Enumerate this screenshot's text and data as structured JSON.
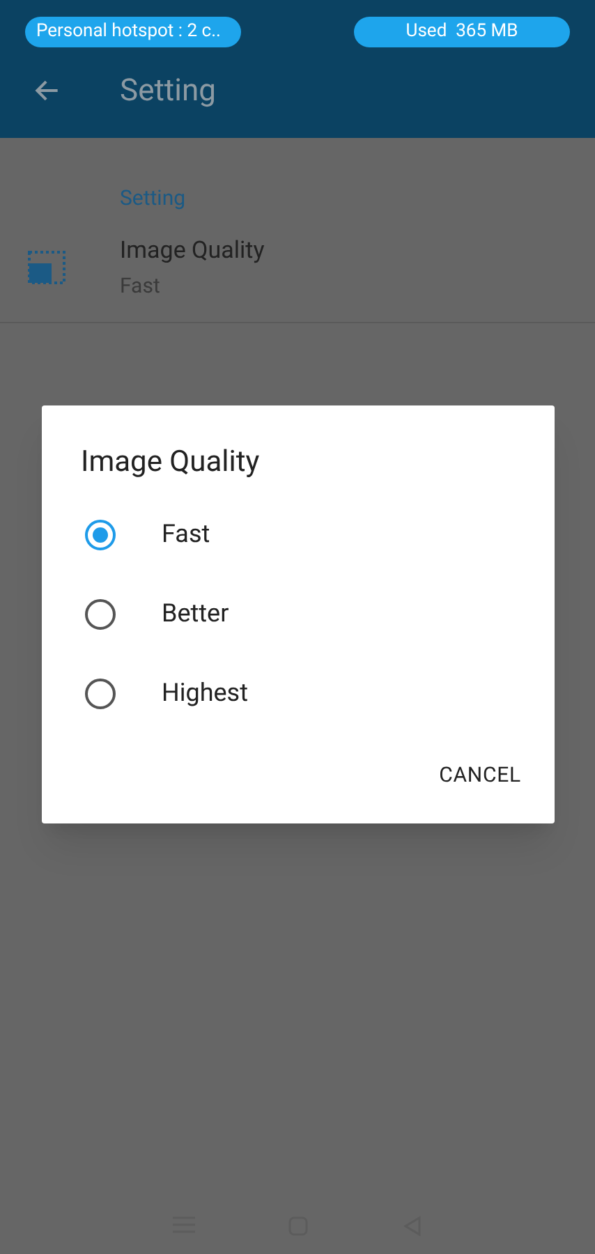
{
  "status_bar": {
    "hotspot": "Personal hotspot : 2 c..",
    "usage": "Used  365 MB"
  },
  "app_bar": {
    "title": "Setting"
  },
  "section": {
    "title": "Setting"
  },
  "settings": [
    {
      "title": "Image Quality",
      "value": "Fast"
    }
  ],
  "dialog": {
    "title": "Image Quality",
    "options": [
      {
        "label": "Fast",
        "selected": true
      },
      {
        "label": "Better",
        "selected": false
      },
      {
        "label": "Highest",
        "selected": false
      }
    ],
    "buttons": [
      "CANCEL"
    ]
  }
}
